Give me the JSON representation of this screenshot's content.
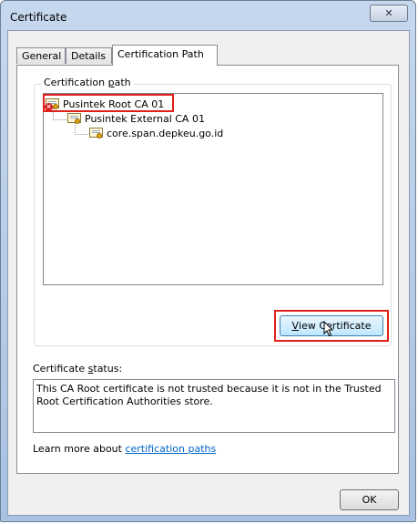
{
  "window": {
    "title": "Certificate",
    "close_glyph": "✕"
  },
  "tabs": [
    {
      "label": "General",
      "active": false
    },
    {
      "label": "Details",
      "active": false
    },
    {
      "label": "Certification Path",
      "active": true
    }
  ],
  "path": {
    "group_label_pre": "Certification ",
    "group_label_accel": "p",
    "group_label_post": "ath",
    "nodes": [
      {
        "label": "Pusintek Root CA 01",
        "icon": "certificate-error-icon",
        "highlighted": true
      },
      {
        "label": "Pusintek External CA 01",
        "icon": "certificate-icon",
        "highlighted": false
      },
      {
        "label": "core.span.depkeu.go.id",
        "icon": "certificate-icon",
        "highlighted": false
      }
    ],
    "view_button_accel": "V",
    "view_button_rest": "iew Certificate",
    "view_button_highlighted": true
  },
  "status": {
    "label_pre": "Certificate ",
    "label_accel": "s",
    "label_post": "tatus:",
    "text": "This CA Root certificate is not trusted because it is not in the Trusted Root Certification Authorities store."
  },
  "learn_more": {
    "prefix": "Learn more about ",
    "link": "certification paths"
  },
  "ok_button": "OK",
  "colors": {
    "highlight_red": "#e0201a",
    "link_blue": "#0066cc",
    "title_bar": "#b8cde8"
  }
}
